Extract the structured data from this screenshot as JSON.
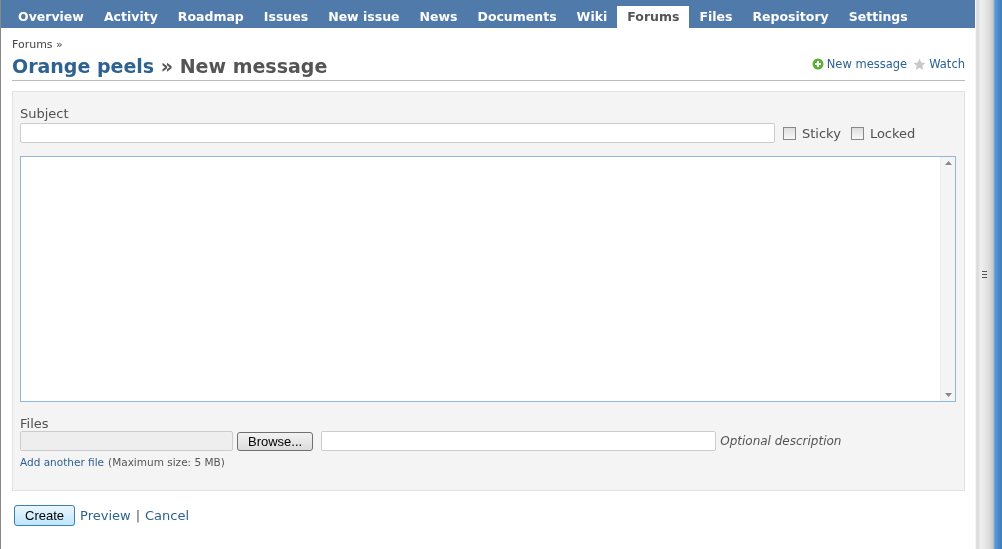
{
  "tabs": [
    {
      "label": "Overview",
      "selected": false
    },
    {
      "label": "Activity",
      "selected": false
    },
    {
      "label": "Roadmap",
      "selected": false
    },
    {
      "label": "Issues",
      "selected": false
    },
    {
      "label": "New issue",
      "selected": false
    },
    {
      "label": "News",
      "selected": false
    },
    {
      "label": "Documents",
      "selected": false
    },
    {
      "label": "Wiki",
      "selected": false
    },
    {
      "label": "Forums",
      "selected": true
    },
    {
      "label": "Files",
      "selected": false
    },
    {
      "label": "Repository",
      "selected": false
    },
    {
      "label": "Settings",
      "selected": false
    }
  ],
  "breadcrumb": "Forums »",
  "title": {
    "board": "Orange peels",
    "separator": "»",
    "page": "New message"
  },
  "actions": [
    {
      "kind": "add",
      "label": "New message"
    },
    {
      "kind": "watch",
      "label": "Watch"
    }
  ],
  "form": {
    "subject_label": "Subject",
    "options": [
      {
        "label": "Sticky",
        "checked": false
      },
      {
        "label": "Locked",
        "checked": false
      }
    ],
    "files_label": "Files",
    "browse": "Browse...",
    "description_hint": "Optional description",
    "add_file": "Add another file",
    "max_size": "(Maximum size: 5 MB)"
  },
  "buttons": {
    "create": "Create",
    "preview": "Preview",
    "separator": "|",
    "cancel": "Cancel"
  }
}
